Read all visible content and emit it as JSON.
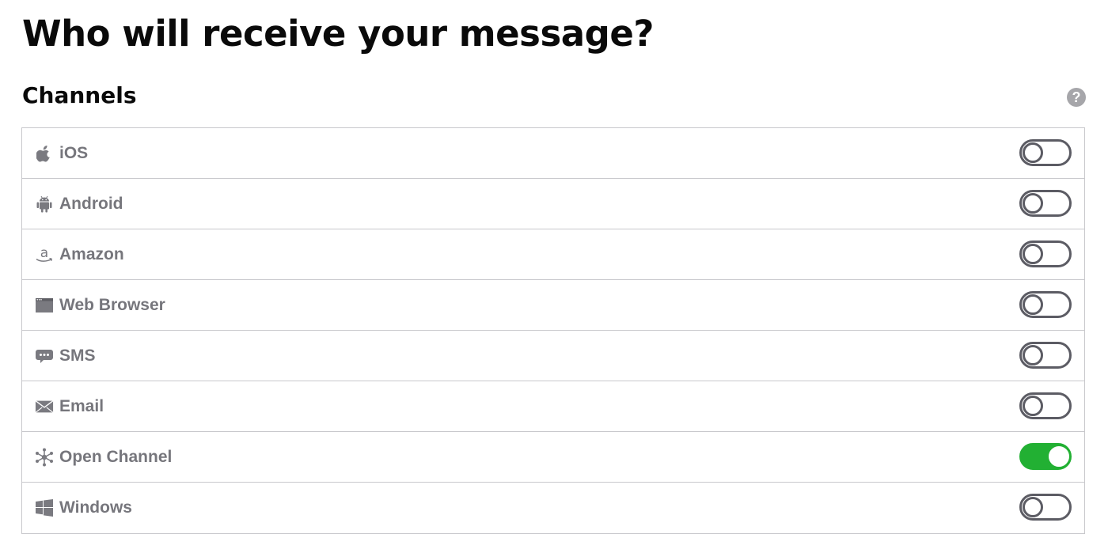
{
  "header": {
    "title": "Who will receive your message?"
  },
  "section": {
    "title": "Channels",
    "help_icon": "question-mark-icon",
    "help_glyph": "?"
  },
  "channels": [
    {
      "label": "iOS",
      "icon": "apple-icon",
      "enabled": false
    },
    {
      "label": "Android",
      "icon": "android-icon",
      "enabled": false
    },
    {
      "label": "Amazon",
      "icon": "amazon-icon",
      "enabled": false
    },
    {
      "label": "Web Browser",
      "icon": "browser-window-icon",
      "enabled": false
    },
    {
      "label": "SMS",
      "icon": "chat-bubble-icon",
      "enabled": false
    },
    {
      "label": "Email",
      "icon": "envelope-icon",
      "enabled": false
    },
    {
      "label": "Open Channel",
      "icon": "network-nodes-icon",
      "enabled": true
    },
    {
      "label": "Windows",
      "icon": "windows-logo-icon",
      "enabled": false
    }
  ],
  "colors": {
    "toggle_on": "#22b033",
    "toggle_off_border": "#5c5c64",
    "label_text": "#76767c",
    "border": "#c8c8cc"
  }
}
